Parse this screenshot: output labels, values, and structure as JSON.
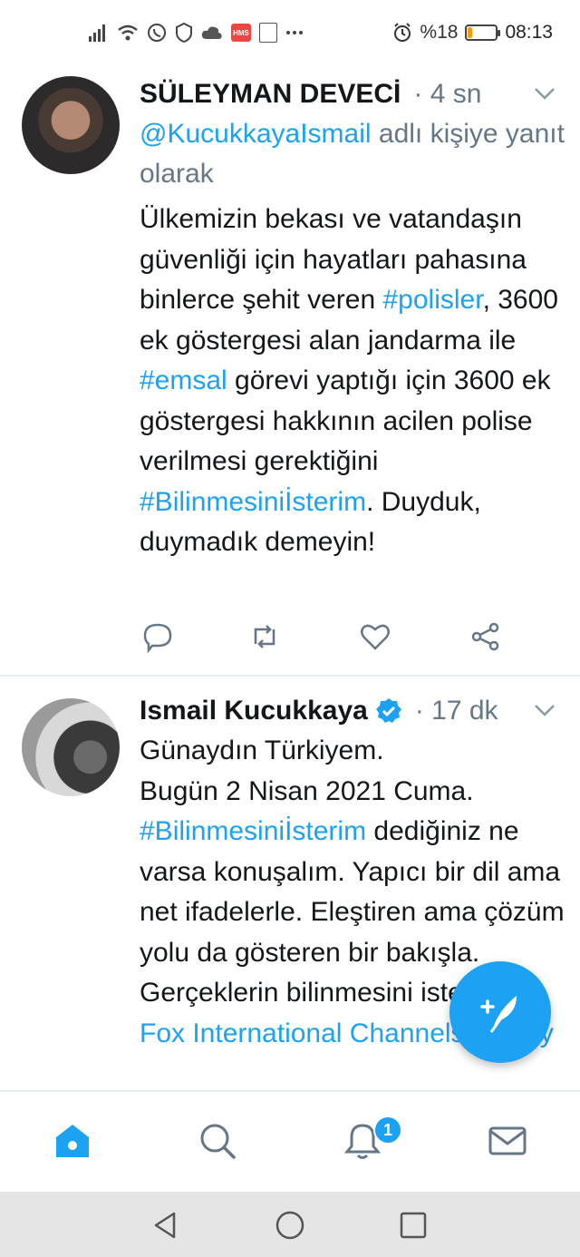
{
  "status_bar": {
    "battery_text": "%18",
    "time": "08:13",
    "battery_level": 0.18,
    "icons": [
      "signal-icon",
      "wifi-icon",
      "whatsapp-icon",
      "shield-icon",
      "cloud-icon",
      "hms-icon",
      "document-icon",
      "more-icon",
      "alarm-icon"
    ]
  },
  "tweets": [
    {
      "author": "SÜLEYMAN DEVECİ",
      "time": "· 4 sn",
      "reply_handle": "@KucukkayaIsmail",
      "reply_suffix": " adlı kişiye yanıt olarak",
      "body_parts": [
        "Ülkemizin bekası ve vatandaşın güvenliği için hayatları pahasına binlerce şehit veren ",
        "#polisler",
        ", 3600 ek göstergesi alan jandarma ile ",
        "#emsal",
        " görevi yaptığı için 3600 ek göstergesi hakkının acilen polise verilmesi gerektiğini ",
        "#Bilinmesiniİsterim",
        ". Duyduk, duymadık demeyin!"
      ]
    },
    {
      "author": "Ismail Kucukkaya",
      "time": "· 17 dk",
      "verified": true,
      "body_line1": "Günaydın Türkiyem.",
      "body_line2": "Bugün 2 Nisan 2021 Cuma.",
      "hashtag": "#Bilinmesiniİsterim",
      "body_rest": " dediğiniz ne varsa konuşalım. Yapıcı bir dil ama net ifadelerle. Eleştiren ama çözüm yolu da gösteren bir bakışla. Gerçeklerin bilinmesini isterim. ",
      "source_link": "– Fox International Channels Turkey"
    }
  ],
  "bottom_nav": {
    "items": [
      "home-icon",
      "search-icon",
      "notifications-icon",
      "messages-icon"
    ],
    "notification_count": "1",
    "accent": "#1da1f2"
  },
  "system_nav": [
    "back",
    "home",
    "recents"
  ]
}
